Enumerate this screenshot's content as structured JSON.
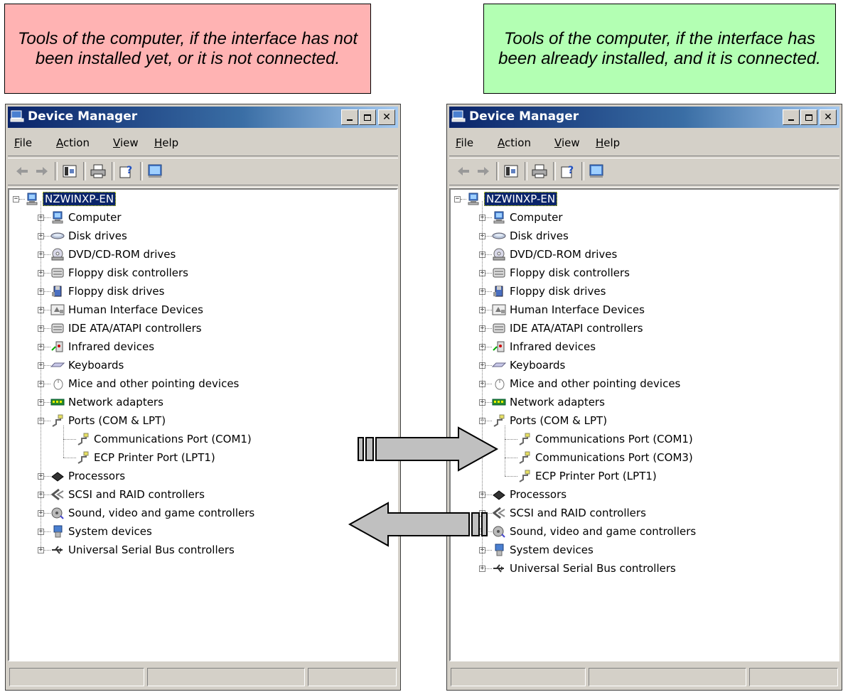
{
  "notes": {
    "left": "Tools of the computer, if the interface has not been installed yet, or it is not connected.",
    "right": "Tools of the computer, if the interface has been already installed, and it is connected."
  },
  "colors": {
    "note_red": "#ffb3b3",
    "note_green": "#b3ffb3",
    "titlebar": "#0a246a",
    "arrow_fill": "#c0c0c0"
  },
  "windows": {
    "left": {
      "title": "Device Manager",
      "menus": [
        {
          "accel": "F",
          "rest": "ile"
        },
        {
          "accel": "A",
          "rest": "ction"
        },
        {
          "accel": "V",
          "rest": "iew"
        },
        {
          "accel": "H",
          "rest": "elp"
        }
      ],
      "root": "NZWINXP-EN",
      "items": [
        {
          "label": "Computer",
          "icon": "computer-icon"
        },
        {
          "label": "Disk drives",
          "icon": "disk-drive-icon"
        },
        {
          "label": "DVD/CD-ROM drives",
          "icon": "cdrom-icon"
        },
        {
          "label": "Floppy disk controllers",
          "icon": "controller-icon"
        },
        {
          "label": "Floppy disk drives",
          "icon": "floppy-icon"
        },
        {
          "label": "Human Interface Devices",
          "icon": "hid-icon"
        },
        {
          "label": "IDE ATA/ATAPI controllers",
          "icon": "controller-icon"
        },
        {
          "label": "Infrared devices",
          "icon": "infrared-icon"
        },
        {
          "label": "Keyboards",
          "icon": "keyboard-icon"
        },
        {
          "label": "Mice and other pointing devices",
          "icon": "mouse-icon"
        },
        {
          "label": "Network adapters",
          "icon": "network-icon"
        },
        {
          "label": "Ports (COM & LPT)",
          "icon": "port-icon",
          "expanded": true,
          "children": [
            "Communications Port (COM1)",
            "ECP Printer Port (LPT1)"
          ]
        },
        {
          "label": "Processors",
          "icon": "processor-icon"
        },
        {
          "label": "SCSI and RAID controllers",
          "icon": "scsi-icon"
        },
        {
          "label": "Sound, video and game controllers",
          "icon": "sound-icon"
        },
        {
          "label": "System devices",
          "icon": "system-icon"
        },
        {
          "label": "Universal Serial Bus controllers",
          "icon": "usb-icon"
        }
      ]
    },
    "right": {
      "title": "Device Manager",
      "menus": [
        {
          "accel": "F",
          "rest": "ile"
        },
        {
          "accel": "A",
          "rest": "ction"
        },
        {
          "accel": "V",
          "rest": "iew"
        },
        {
          "accel": "H",
          "rest": "elp"
        }
      ],
      "root": "NZWINXP-EN",
      "items": [
        {
          "label": "Computer",
          "icon": "computer-icon"
        },
        {
          "label": "Disk drives",
          "icon": "disk-drive-icon"
        },
        {
          "label": "DVD/CD-ROM drives",
          "icon": "cdrom-icon"
        },
        {
          "label": "Floppy disk controllers",
          "icon": "controller-icon"
        },
        {
          "label": "Floppy disk drives",
          "icon": "floppy-icon"
        },
        {
          "label": "Human Interface Devices",
          "icon": "hid-icon"
        },
        {
          "label": "IDE ATA/ATAPI controllers",
          "icon": "controller-icon"
        },
        {
          "label": "Infrared devices",
          "icon": "infrared-icon"
        },
        {
          "label": "Keyboards",
          "icon": "keyboard-icon"
        },
        {
          "label": "Mice and other pointing devices",
          "icon": "mouse-icon"
        },
        {
          "label": "Network adapters",
          "icon": "network-icon"
        },
        {
          "label": "Ports (COM & LPT)",
          "icon": "port-icon",
          "expanded": true,
          "children": [
            "Communications Port (COM1)",
            "Communications Port (COM3)",
            "ECP Printer Port (LPT1)"
          ]
        },
        {
          "label": "Processors",
          "icon": "processor-icon"
        },
        {
          "label": "SCSI and RAID controllers",
          "icon": "scsi-icon"
        },
        {
          "label": "Sound, video and game controllers",
          "icon": "sound-icon"
        },
        {
          "label": "System devices",
          "icon": "system-icon"
        },
        {
          "label": "Universal Serial Bus controllers",
          "icon": "usb-icon"
        }
      ]
    }
  }
}
